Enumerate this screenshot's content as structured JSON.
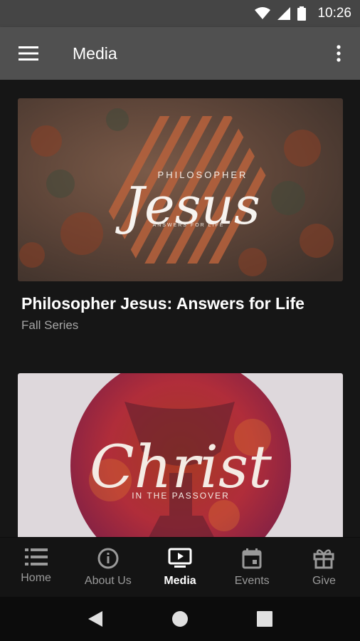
{
  "status_bar": {
    "time": "10:26"
  },
  "app_bar": {
    "title": "Media"
  },
  "media_items": [
    {
      "title": "Philosopher Jesus: Answers for Life",
      "subtitle": "Fall Series",
      "art": {
        "small_top": "PHILOSOPHER",
        "script": "Jesus",
        "small_bottom": "ANSWERS FOR LIFE"
      }
    },
    {
      "art": {
        "script": "Christ",
        "small_bottom": "IN THE PASSOVER"
      }
    }
  ],
  "bottom_nav": {
    "items": [
      {
        "label": "Home",
        "icon": "list-icon",
        "active": false
      },
      {
        "label": "About Us",
        "icon": "info-icon",
        "active": false
      },
      {
        "label": "Media",
        "icon": "tv-play-icon",
        "active": true
      },
      {
        "label": "Events",
        "icon": "calendar-icon",
        "active": false
      },
      {
        "label": "Give",
        "icon": "gift-icon",
        "active": false
      }
    ]
  },
  "colors": {
    "app_bar": "#505050",
    "status_bar": "#454545",
    "background": "#161616",
    "nav_active": "#ffffff",
    "nav_inactive": "#9a9a9a"
  }
}
